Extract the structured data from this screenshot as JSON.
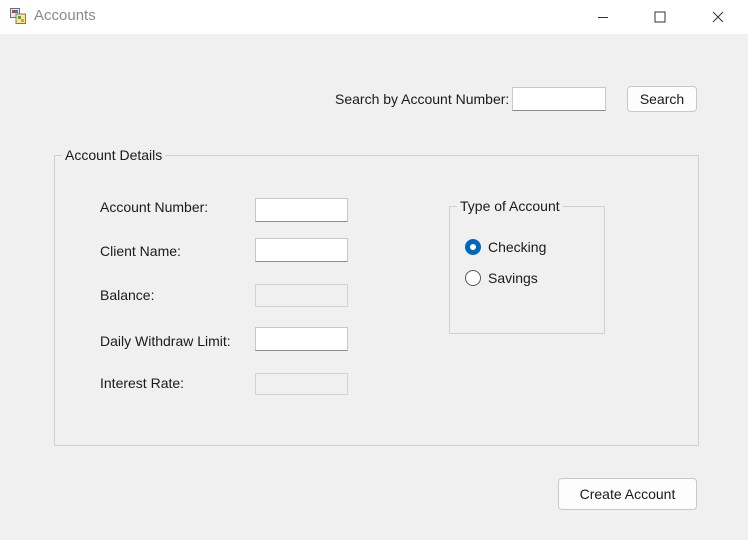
{
  "window": {
    "title": "Accounts"
  },
  "search": {
    "label": "Search by Account Number:",
    "value": "",
    "button_label": "Search"
  },
  "details": {
    "group_title": "Account Details",
    "account_number_label": "Account Number:",
    "account_number_value": "",
    "client_name_label": "Client Name:",
    "client_name_value": "",
    "balance_label": "Balance:",
    "balance_value": "",
    "daily_limit_label": "Daily Withdraw Limit:",
    "daily_limit_value": "",
    "interest_rate_label": "Interest Rate:",
    "interest_rate_value": ""
  },
  "account_type": {
    "group_title": "Type of Account",
    "options": [
      {
        "label": "Checking",
        "checked": true
      },
      {
        "label": "Savings",
        "checked": false
      }
    ]
  },
  "actions": {
    "create_label": "Create Account"
  },
  "icons": {
    "app": "accounts-app-icon",
    "minimize": "minimize-icon",
    "maximize": "maximize-icon",
    "close": "close-icon"
  },
  "colors": {
    "accent": "#0067c0",
    "form_background": "#f0f0f0",
    "titlebar_background": "#ffffff"
  }
}
